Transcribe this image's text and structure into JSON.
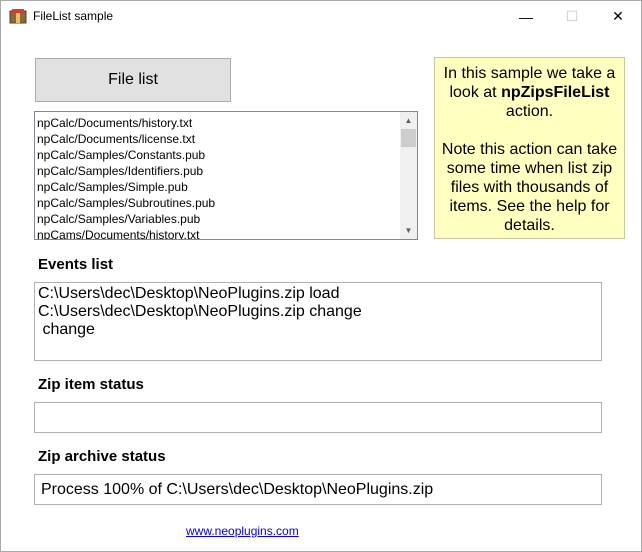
{
  "window": {
    "title": "FileList sample",
    "minimize_glyph": "—",
    "maximize_glyph": "☐",
    "close_glyph": "✕",
    "app_icon": "app-icon"
  },
  "file_list_button": {
    "label": "File list"
  },
  "file_list": {
    "items": [
      "npCalc/Documents/history.txt",
      "npCalc/Documents/license.txt",
      "npCalc/Samples/Constants.pub",
      "npCalc/Samples/Identifiers.pub",
      "npCalc/Samples/Simple.pub",
      "npCalc/Samples/Subroutines.pub",
      "npCalc/Samples/Variables.pub",
      "npCams/Documents/history.txt"
    ]
  },
  "note": {
    "line1": "In this sample we take a",
    "line2_prefix": "look at ",
    "line2_bold": "npZipsFileList",
    "line3": "action.",
    "line4": "Note this action can take",
    "line5": "some time when list zip",
    "line6": "files with thousands of",
    "line7": "items. See the help for",
    "line8": "details."
  },
  "events": {
    "label": "Events list",
    "lines": [
      "C:\\Users\\dec\\Desktop\\NeoPlugins.zip load",
      "C:\\Users\\dec\\Desktop\\NeoPlugins.zip change",
      " change"
    ]
  },
  "zip_item_status": {
    "label": "Zip item status",
    "value": ""
  },
  "zip_archive_status": {
    "label": "Zip archive status",
    "value": "Process 100% of C:\\Users\\dec\\Desktop\\NeoPlugins.zip"
  },
  "link": {
    "text": "www.neoplugins.com"
  }
}
